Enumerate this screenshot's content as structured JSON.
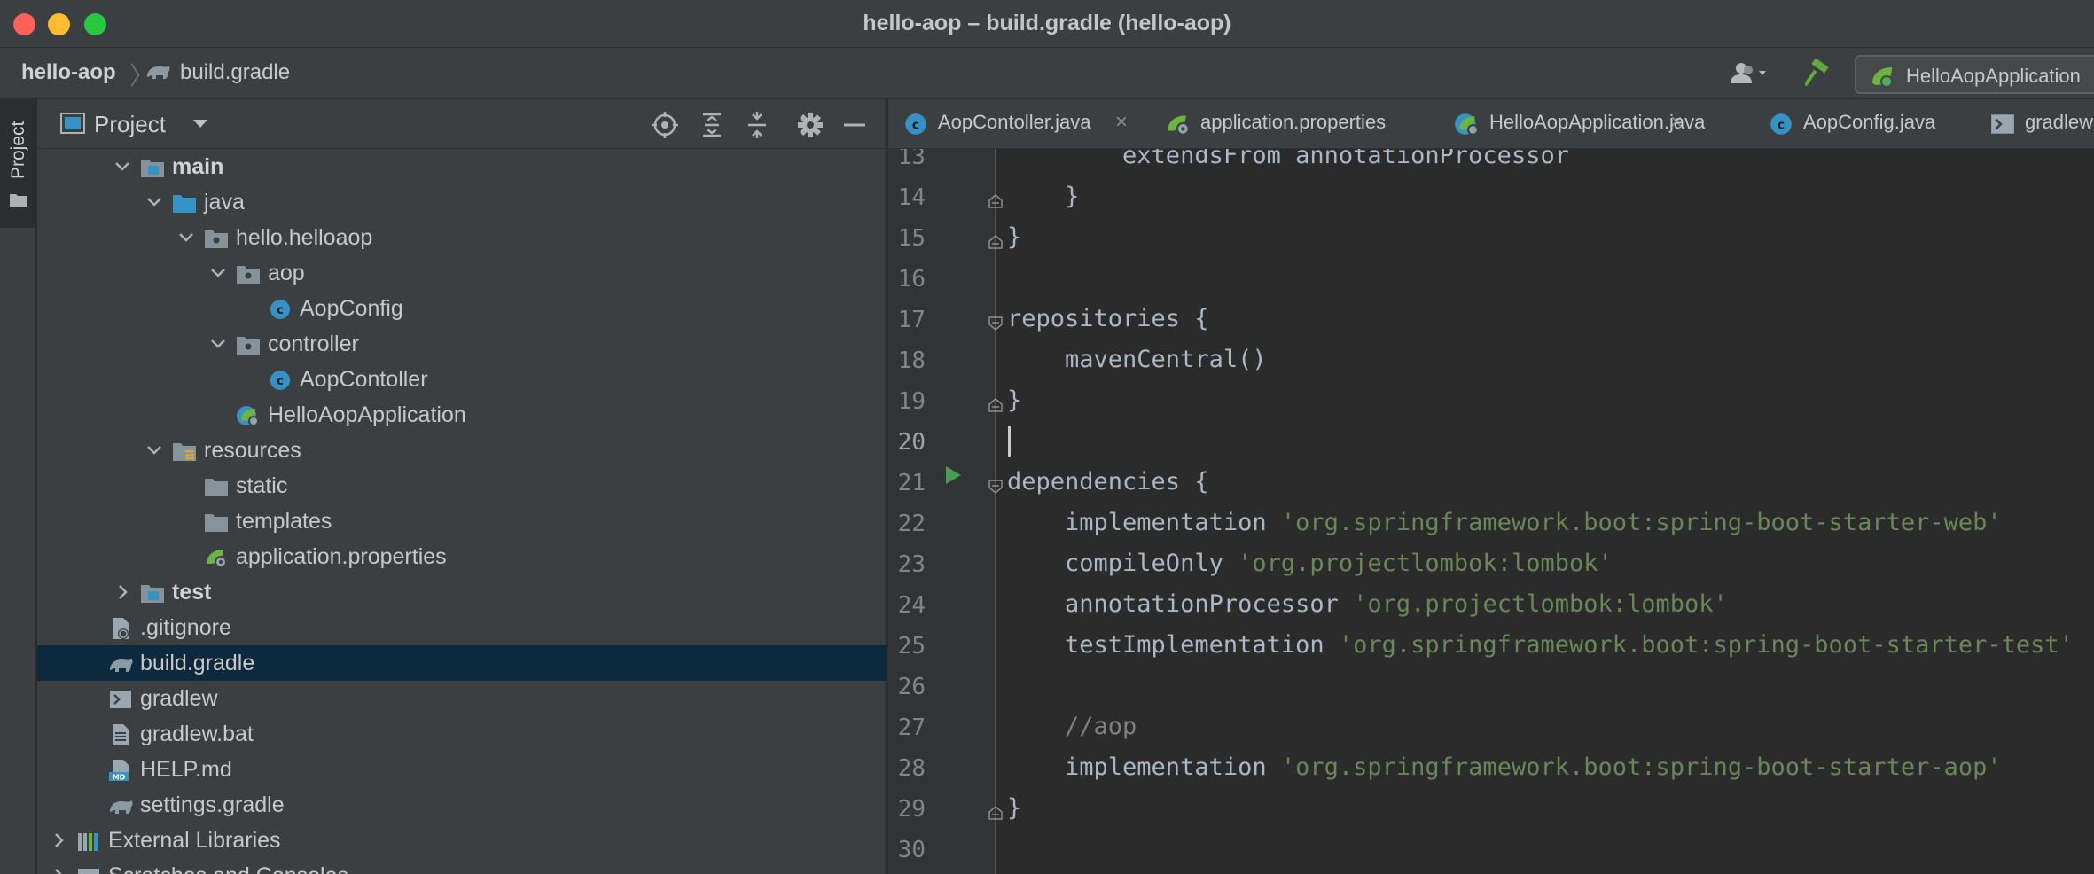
{
  "window": {
    "title": "hello-aop – build.gradle (hello-aop)"
  },
  "navbar": {
    "project": "hello-aop",
    "separator": "〉",
    "file": "build.gradle",
    "run_config": "HelloAopApplication"
  },
  "stripe": {
    "project_label": "Project"
  },
  "panel": {
    "title": "Project",
    "tree": [
      {
        "label": "main",
        "bold": true,
        "expanded": true,
        "icon": "source-folder-icon"
      },
      {
        "label": "java",
        "expanded": true,
        "icon": "java-folder-icon"
      },
      {
        "label": "hello.helloaop",
        "expanded": true,
        "icon": "package-icon"
      },
      {
        "label": "aop",
        "expanded": true,
        "icon": "package-icon"
      },
      {
        "label": "AopConfig",
        "icon": "class-icon"
      },
      {
        "label": "controller",
        "expanded": true,
        "icon": "package-icon"
      },
      {
        "label": "AopContoller",
        "icon": "class-icon"
      },
      {
        "label": "HelloAopApplication",
        "icon": "spring-app-icon"
      },
      {
        "label": "resources",
        "expanded": true,
        "icon": "resources-folder-icon"
      },
      {
        "label": "static",
        "icon": "folder-icon"
      },
      {
        "label": "templates",
        "icon": "folder-icon"
      },
      {
        "label": "application.properties",
        "icon": "spring-properties-icon"
      },
      {
        "label": "test",
        "bold": true,
        "expanded": false,
        "icon": "source-folder-icon"
      },
      {
        "label": ".gitignore",
        "icon": "gitignore-icon"
      },
      {
        "label": "build.gradle",
        "selected": true,
        "icon": "gradle-icon"
      },
      {
        "label": "gradlew",
        "icon": "terminal-file-icon"
      },
      {
        "label": "gradlew.bat",
        "icon": "text-file-icon"
      },
      {
        "label": "HELP.md",
        "icon": "markdown-icon"
      },
      {
        "label": "settings.gradle",
        "icon": "gradle-icon"
      },
      {
        "label": "External Libraries",
        "expanded": false,
        "icon": "libraries-icon"
      },
      {
        "label": "Scratches and Consoles",
        "expanded": false,
        "icon": "scratches-icon"
      }
    ]
  },
  "tabs": [
    {
      "label": "AopContoller.java",
      "icon": "class-icon"
    },
    {
      "label": "application.properties",
      "icon": "spring-properties-icon"
    },
    {
      "label": "HelloAopApplication.java",
      "icon": "spring-app-icon"
    },
    {
      "label": "AopConfig.java",
      "icon": "class-icon"
    },
    {
      "label": "gradlew",
      "icon": "terminal-file-icon"
    }
  ],
  "editor": {
    "current_line": 20,
    "lines": [
      {
        "num": "13",
        "parts": [
          [
            "plain",
            "        extendsFrom annotationProcessor"
          ]
        ]
      },
      {
        "num": "14",
        "parts": [
          [
            "plain",
            "    }"
          ]
        ]
      },
      {
        "num": "15",
        "parts": [
          [
            "plain",
            "}"
          ]
        ]
      },
      {
        "num": "16",
        "parts": []
      },
      {
        "num": "17",
        "parts": [
          [
            "plain",
            "repositories {"
          ]
        ]
      },
      {
        "num": "18",
        "parts": [
          [
            "plain",
            "    mavenCentral()"
          ]
        ]
      },
      {
        "num": "19",
        "parts": [
          [
            "plain",
            "}"
          ]
        ]
      },
      {
        "num": "20",
        "parts": []
      },
      {
        "num": "21",
        "parts": [
          [
            "plain",
            "dependencies {"
          ]
        ]
      },
      {
        "num": "22",
        "parts": [
          [
            "plain",
            "    implementation "
          ],
          [
            "str",
            "'org.springframework.boot:spring-boot-starter-web'"
          ]
        ]
      },
      {
        "num": "23",
        "parts": [
          [
            "plain",
            "    compileOnly "
          ],
          [
            "str",
            "'org.projectlombok:lombok'"
          ]
        ]
      },
      {
        "num": "24",
        "parts": [
          [
            "plain",
            "    annotationProcessor "
          ],
          [
            "str",
            "'org.projectlombok:lombok'"
          ]
        ]
      },
      {
        "num": "25",
        "parts": [
          [
            "plain",
            "    testImplementation "
          ],
          [
            "str",
            "'org.springframework.boot:spring-boot-starter-test'"
          ]
        ]
      },
      {
        "num": "26",
        "parts": []
      },
      {
        "num": "27",
        "parts": [
          [
            "cmt",
            "    //aop"
          ]
        ]
      },
      {
        "num": "28",
        "parts": [
          [
            "plain",
            "    implementation "
          ],
          [
            "str",
            "'org.springframework.boot:spring-boot-starter-aop'"
          ]
        ]
      },
      {
        "num": "29",
        "parts": [
          [
            "plain",
            "}"
          ]
        ]
      },
      {
        "num": "30",
        "parts": []
      }
    ]
  },
  "colors": {
    "accent_selection": "#0d293e",
    "string": "#6a8759",
    "comment": "#808080",
    "code": "#a9b7c6",
    "class_icon": "#3592c4",
    "spring_green": "#6db33f",
    "run_green": "#499c54"
  }
}
